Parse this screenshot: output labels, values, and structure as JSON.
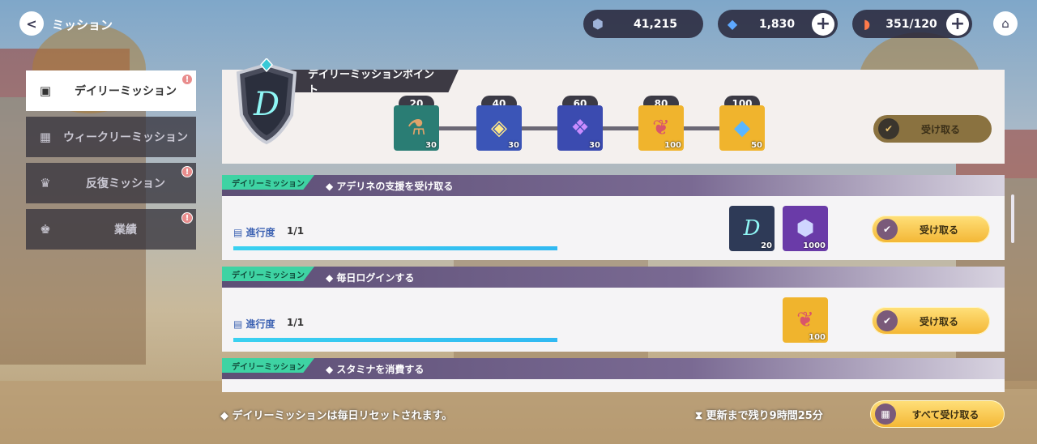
{
  "header": {
    "title": "ミッション",
    "resources": [
      {
        "icon": "gold-coin-icon",
        "value": "41,215"
      },
      {
        "icon": "blue-gem-icon",
        "value": "1,830"
      },
      {
        "icon": "stamina-flame-icon",
        "value": "351/120"
      }
    ]
  },
  "sidebar": {
    "items": [
      {
        "label": "デイリーミッション",
        "icon": "clipboard-icon",
        "active": true,
        "badge": "!"
      },
      {
        "label": "ウィークリーミッション",
        "icon": "calendar-icon",
        "active": false,
        "badge": ""
      },
      {
        "label": "反復ミッション",
        "icon": "repeat-trophy-icon",
        "active": false,
        "badge": "!"
      },
      {
        "label": "業績",
        "icon": "trophy-icon",
        "active": false,
        "badge": "!"
      }
    ]
  },
  "points": {
    "title": "デイリーミッションポイント",
    "shield_letter": "D",
    "milestones": [
      {
        "points": "20",
        "reward": "potion-icon",
        "qty": "30",
        "color": "#2a7d74"
      },
      {
        "points": "40",
        "reward": "rainbow-gem-icon",
        "qty": "30",
        "color": "#3b55b7"
      },
      {
        "points": "60",
        "reward": "purple-crystal-icon",
        "qty": "30",
        "color": "#3b4bb0"
      },
      {
        "points": "80",
        "reward": "angel-wing-icon",
        "qty": "100",
        "color": "#f0b42d"
      },
      {
        "points": "100",
        "reward": "diamond-icon",
        "qty": "50",
        "color": "#f0b42d"
      }
    ],
    "claim_label": "受け取る"
  },
  "missions": [
    {
      "tag": "デイリーミッション",
      "title": "アデリネの支援を受け取る",
      "progress_label": "進行度",
      "progress_value": "1/1",
      "progress_fraction": 1.0,
      "rewards": [
        {
          "icon": "daily-shield-icon",
          "qty": "20",
          "color": "#2e3a57"
        },
        {
          "icon": "hex-token-icon",
          "qty": "1000",
          "color": "#6a3ba8"
        }
      ],
      "claim_label": "受け取る"
    },
    {
      "tag": "デイリーミッション",
      "title": "毎日ログインする",
      "progress_label": "進行度",
      "progress_value": "1/1",
      "progress_fraction": 1.0,
      "rewards": [
        {
          "icon": "angel-wing-icon",
          "qty": "100",
          "color": "#f0b42d"
        }
      ],
      "claim_label": "受け取る"
    },
    {
      "tag": "デイリーミッション",
      "title": "スタミナを消費する"
    }
  ],
  "footer": {
    "note": "◆ デイリーミッションは毎日リセットされます。",
    "timer": "更新まで残り9時間25分",
    "claim_all_label": "すべて受け取る"
  }
}
